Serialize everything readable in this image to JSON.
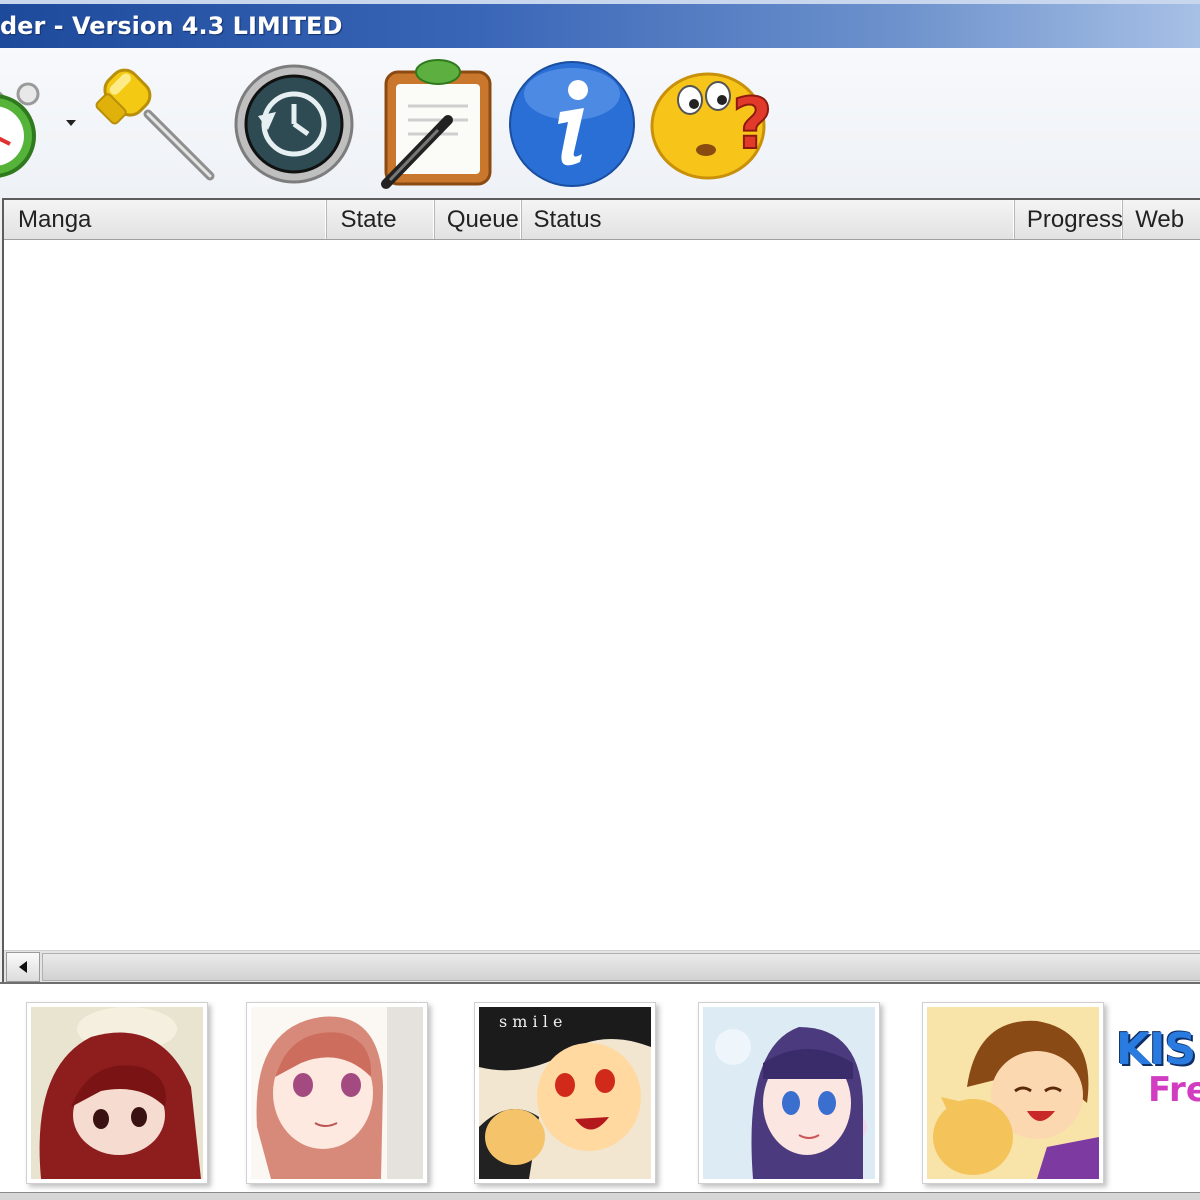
{
  "window": {
    "title": "der - Version 4.3 LIMITED"
  },
  "toolbar": {
    "buttons": [
      {
        "icon": "alarm-clock-icon"
      },
      {
        "icon": "screwdriver-icon"
      },
      {
        "icon": "time-machine-icon"
      },
      {
        "icon": "clipboard-pen-icon"
      },
      {
        "icon": "info-icon"
      },
      {
        "icon": "confused-smiley-icon"
      }
    ]
  },
  "listview": {
    "columns": [
      "Manga",
      "State",
      "Queue",
      "Status",
      "Progress",
      "Web"
    ],
    "rows": []
  },
  "banner": {
    "thumbnails": [
      {
        "icon": "manga-cover-1"
      },
      {
        "icon": "manga-cover-2"
      },
      {
        "icon": "manga-cover-3",
        "caption": "s m i l e"
      },
      {
        "icon": "manga-cover-4"
      },
      {
        "icon": "manga-cover-5"
      }
    ],
    "brand": "KIS",
    "tagline": "Fre"
  },
  "colors": {
    "title_bar_start": "#1e4a9c",
    "title_bar_end": "#a7c0e6",
    "brand_blue": "#2a7be0",
    "tagline_magenta": "#d23cc0"
  }
}
